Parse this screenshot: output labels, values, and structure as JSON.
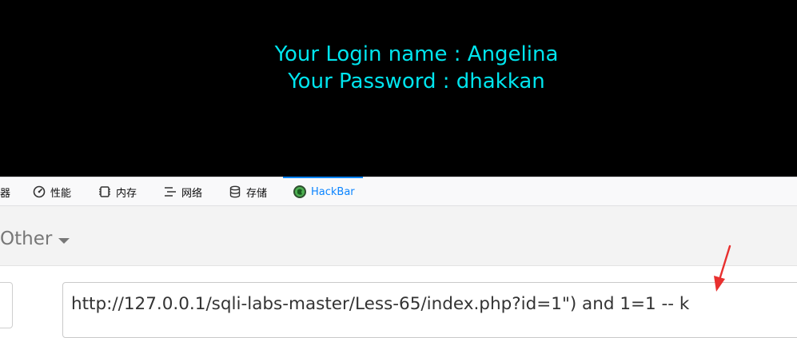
{
  "page": {
    "login_line": "Your Login name : Angelina",
    "password_line": "Your Password : dhakkan"
  },
  "devtools": {
    "tabs": [
      {
        "label": "器",
        "icon": "cut-off-tab"
      },
      {
        "label": "性能",
        "icon": "performance-gauge-icon"
      },
      {
        "label": "内存",
        "icon": "memory-chip-icon"
      },
      {
        "label": "网络",
        "icon": "network-icon"
      },
      {
        "label": "存储",
        "icon": "storage-database-icon"
      },
      {
        "label": "HackBar",
        "icon": "hackbar-icon",
        "active": true
      }
    ]
  },
  "hackbar": {
    "menu_label": "Other",
    "url_value": "http://127.0.0.1/sqli-labs-master/Less-65/index.php?id=1\") and 1=1 -- k"
  },
  "colors": {
    "page_text": "#00e5ee",
    "active_tab": "#0a84ff",
    "annotation_arrow": "#e8302f"
  }
}
